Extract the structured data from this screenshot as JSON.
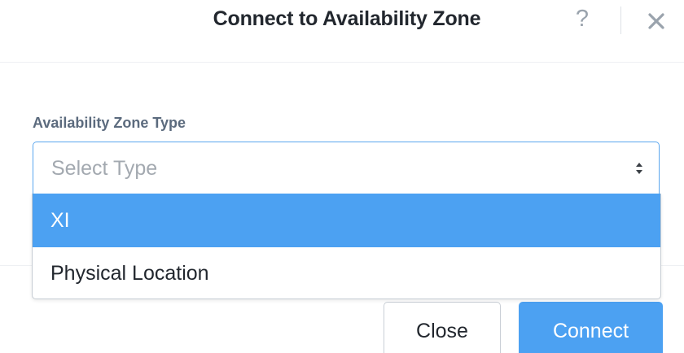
{
  "dialog": {
    "title": "Connect to Availability Zone",
    "help_glyph": "?",
    "close_icon": "close-icon"
  },
  "form": {
    "field_label": "Availability Zone Type",
    "select": {
      "placeholder": "Select Type",
      "options": [
        {
          "label": "XI",
          "highlighted": true
        },
        {
          "label": "Physical Location",
          "highlighted": false
        }
      ]
    }
  },
  "footer": {
    "close_label": "Close",
    "connect_label": "Connect"
  },
  "colors": {
    "accent": "#4ca1f2",
    "select_border": "#5aa6ee",
    "label": "#5c6b7e",
    "title": "#22272e"
  }
}
